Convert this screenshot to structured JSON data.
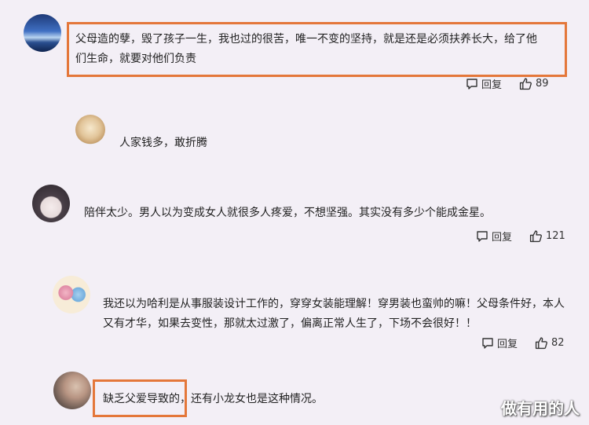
{
  "comments": [
    {
      "text_line1": "父母造的孽，毁了孩子一生，我也过的很苦，唯一不变的坚持，就是还是必须扶养长大，给了他",
      "text_line2": "们生命，就要对他们负责",
      "reply_label": "回复",
      "likes": "89",
      "avatar": "sea-landscape-avatar"
    },
    {
      "text": "人家钱多，敢折腾",
      "avatar": "puppy-avatar"
    },
    {
      "text": "陪伴太少。男人以为变成女人就很多人疼爱，不想坚强。其实没有多少个能成金星。",
      "reply_label": "回复",
      "likes": "121",
      "avatar": "anime-girl-avatar"
    },
    {
      "text_line1": "我还以为哈利是从事服装设计工作的，穿穿女装能理解！穿男装也蛮帅的嘛！父母条件好，本人",
      "text_line2": "又有才华，如果去变性，那就太过激了，偏离正常人生了，下场不会很好！！",
      "reply_label": "回复",
      "likes": "82",
      "avatar": "cartoon-couple-avatar"
    },
    {
      "text_highlight": "缺乏父爱导致的",
      "text_rest": "，还有小龙女也是这种情况。",
      "avatar": "photo-avatar"
    }
  ],
  "watermark": "做有用的人",
  "colors": {
    "background": "#f3eff6",
    "highlight_border": "#e4773a"
  }
}
